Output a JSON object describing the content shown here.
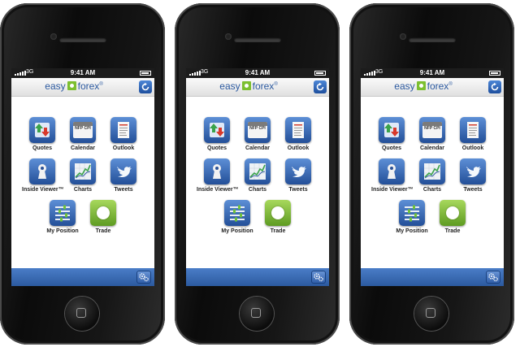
{
  "status_bar": {
    "carrier": "3G",
    "time": "9:41 AM"
  },
  "nav": {
    "logo_left": "easy",
    "logo_right": "forex",
    "logo_reg": "®"
  },
  "apps": {
    "quotes": "Quotes",
    "calendar": "Calendar",
    "calendar_icon_text": "NFP CPI",
    "outlook": "Outlook",
    "inside_viewer": "Inside Viewer™",
    "charts": "Charts",
    "tweets": "Tweets",
    "my_position": "My Position",
    "trade": "Trade"
  },
  "icons": {
    "refresh": "refresh-icon",
    "settings": "gears-icon",
    "quotes": "up-down-arrows-icon",
    "calendar": "calendar-icon",
    "outlook": "document-icon",
    "inside_viewer": "keyhole-icon",
    "charts": "line-chart-icon",
    "tweets": "twitter-bird-icon",
    "my_position": "sliders-icon",
    "trade": "circle-icon"
  },
  "colors": {
    "brand_blue": "#2c5aa0",
    "brand_green": "#7cbf2f",
    "tab_bar": "#3a6bb5",
    "phone_body": "#111111"
  }
}
